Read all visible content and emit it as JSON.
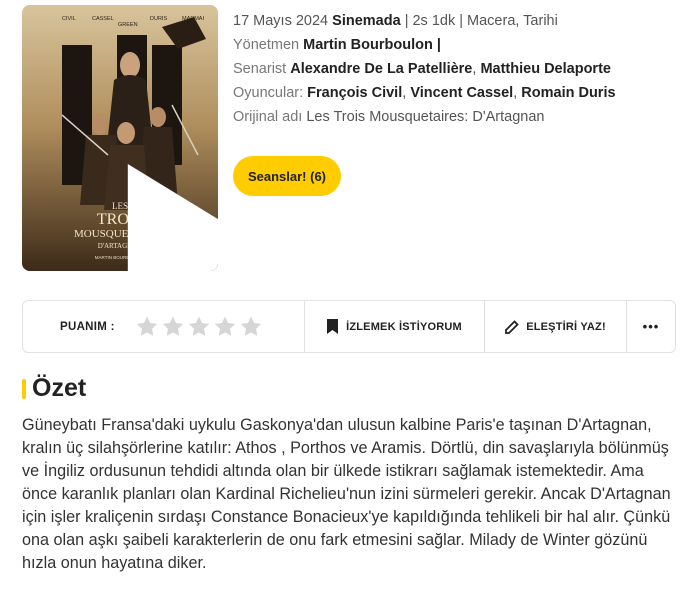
{
  "poster": {
    "credits": [
      "CIVIL",
      "CASSEL",
      "GREEN",
      "DURIS",
      "MARMAI"
    ],
    "title_line1": "LES",
    "title_line2": "TROIS",
    "title_line3": "MOUSQUETAIRES",
    "title_line4": "D'ARTAGNAN",
    "director": "MARTIN BOURBOULON"
  },
  "meta": {
    "date": "17 Mayıs 2024",
    "status": "Sinemada",
    "duration": "| 2s 1dk |",
    "genres": "Macera, Tarihi",
    "director_label": "Yönetmen",
    "director": "Martin Bourboulon",
    "director_sep": " |",
    "writer_label": "Senarist",
    "writers": [
      "Alexandre De La Patellière",
      "Matthieu Delaporte"
    ],
    "cast_label": "Oyuncular:",
    "cast": [
      "François Civil",
      "Vincent Cassel",
      "Romain Duris"
    ],
    "original_label": "Orijinal adı",
    "original_title": "Les Trois Mousquetaires: D'Artagnan"
  },
  "seanslar_label": "Seanslar! (6)",
  "actions": {
    "rating_label": "PUANIM :",
    "stars": 5,
    "watchlist_label": "İZLEMEK İSTİYORUM",
    "review_label": "ELEŞTİRİ YAZ!",
    "more_label": "•••"
  },
  "summary": {
    "title": "Özet",
    "text": "Güneybatı Fransa'daki uykulu Gaskonya'dan ulusun kalbine Paris'e taşınan D'Artagnan, kralın üç silahşörlerine katılır: Athos , Porthos ve Aramis. Dörtlü, din savaşlarıyla bölünmüş ve İngiliz ordusunun tehdidi altında olan bir ülkede istikrarı sağlamak istemektedir. Ama önce karanlık planları olan Kardinal Richelieu'nun izini sürmeleri gerekir. Ancak D'Artagnan için işler kraliçenin sırdaşı Constance Bonacieux'ye kapıldığında tehlikeli bir hal alır. Çünkü ona olan aşkı şaibeli karakterlerin de onu fark etmesini sağlar. Milady de Winter gözünü hızla onun hayatına diker."
  },
  "colors": {
    "accent": "#ffcc00",
    "star": "#d6d6d6"
  }
}
